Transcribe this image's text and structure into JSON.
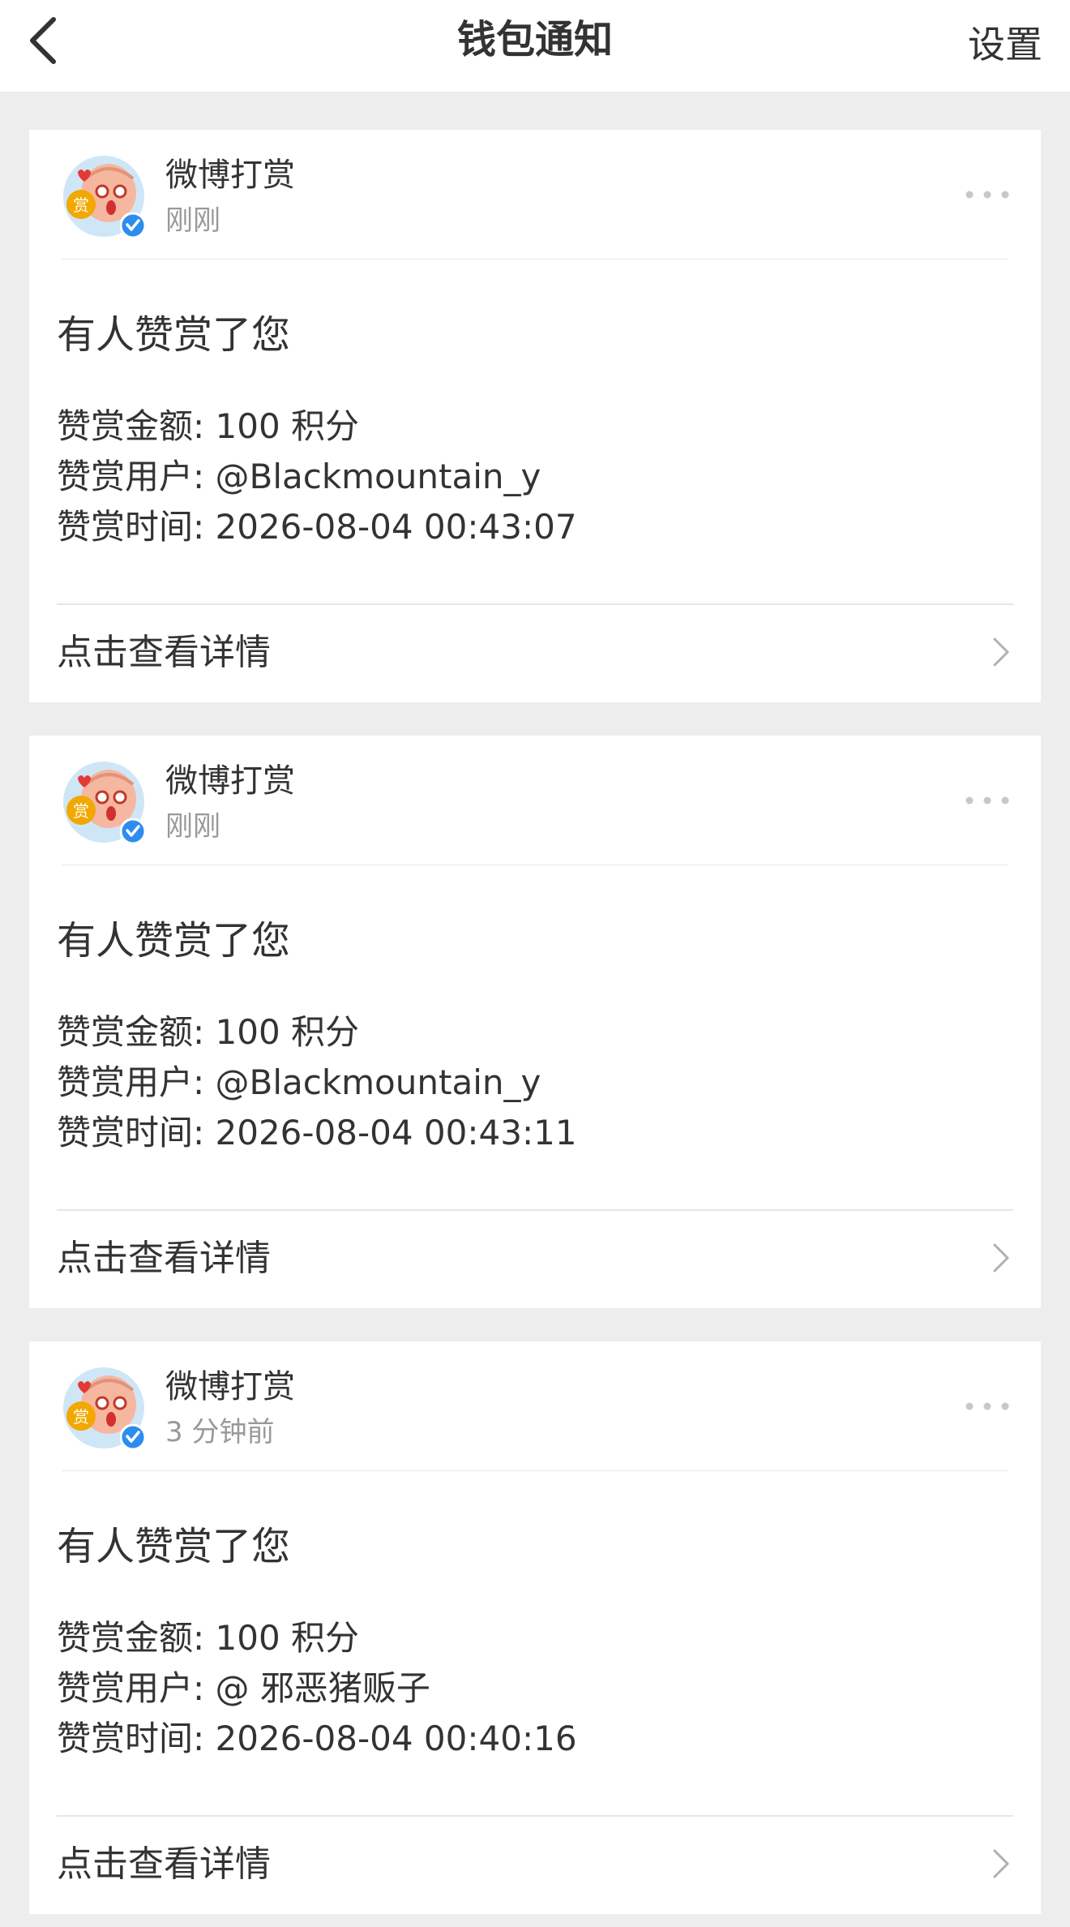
{
  "navbar": {
    "back_icon": "chevron-left-icon",
    "title": "钱包通知",
    "settings_label": "设置"
  },
  "colors": {
    "background": "#ededed",
    "card": "#ffffff",
    "text_primary": "#333333",
    "text_secondary": "#999999",
    "verified_badge": "#2d8cf0",
    "avatar_badge": "#f2a800"
  },
  "notifications": [
    {
      "sender": "微博打赏",
      "time": "刚刚",
      "avatar_icon": "reward-mascot-avatar",
      "verified_icon": "verified-badge-icon",
      "title": "有人赞赏了您",
      "amount_line": "赞赏金额: 100 积分",
      "user_line": "赞赏用户: @Blackmountain_y",
      "time_line": "赞赏时间: 2026-08-04 00:43:07",
      "footer_label": "点击查看详情"
    },
    {
      "sender": "微博打赏",
      "time": "刚刚",
      "avatar_icon": "reward-mascot-avatar",
      "verified_icon": "verified-badge-icon",
      "title": "有人赞赏了您",
      "amount_line": "赞赏金额: 100 积分",
      "user_line": "赞赏用户: @Blackmountain_y",
      "time_line": "赞赏时间: 2026-08-04 00:43:11",
      "footer_label": "点击查看详情"
    },
    {
      "sender": "微博打赏",
      "time": "3 分钟前",
      "avatar_icon": "reward-mascot-avatar",
      "verified_icon": "verified-badge-icon",
      "title": "有人赞赏了您",
      "amount_line": "赞赏金额: 100 积分",
      "user_line": "赞赏用户: @ 邪恶猪贩子",
      "time_line": "赞赏时间: 2026-08-04 00:40:16",
      "footer_label": "点击查看详情"
    }
  ]
}
